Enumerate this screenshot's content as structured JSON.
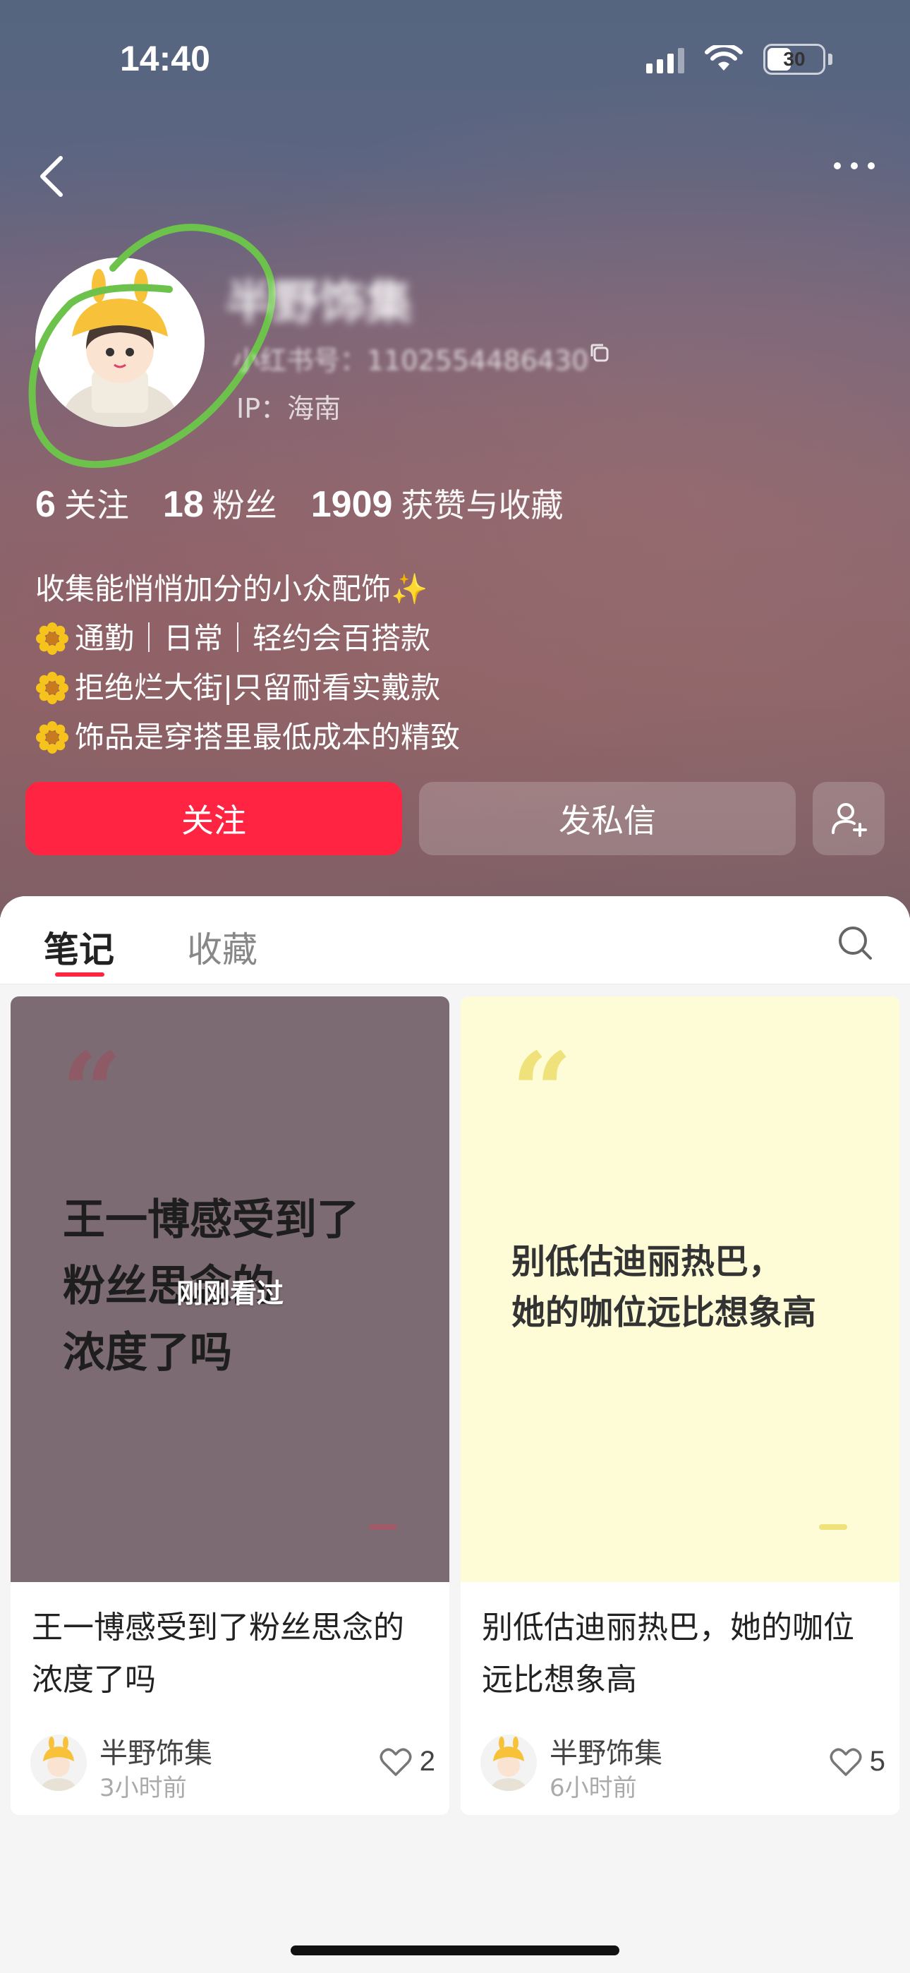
{
  "status_bar": {
    "time": "14:40",
    "battery": "30"
  },
  "profile": {
    "name": "半野饰集",
    "redbook_id": "小红书号：1102554486430",
    "ip": "IP：海南"
  },
  "stats": [
    {
      "num": "6",
      "label": "关注"
    },
    {
      "num": "18",
      "label": "粉丝"
    },
    {
      "num": "1909",
      "label": "获赞与收藏"
    }
  ],
  "bio": {
    "line1": "收集能悄悄加分的小众配饰✨",
    "line2": "通勤｜日常｜轻约会百搭款",
    "line3": "拒绝烂大街|只留耐看实戴款",
    "line4": "饰品是穿搭里最低成本的精致"
  },
  "actions": {
    "follow": "关注",
    "message": "发私信"
  },
  "tabs": {
    "notes": "笔记",
    "collect": "收藏"
  },
  "notes": [
    {
      "cover_line1": "王一博感受到了",
      "cover_line2": "粉丝思念的",
      "cover_line3": "浓度了吗",
      "seen": "刚刚看过",
      "title": "王一博感受到了粉丝思念的浓度了吗",
      "author": "半野饰集",
      "time": "3小时前",
      "likes": "2"
    },
    {
      "cover_line1": "别低估迪丽热巴，",
      "cover_line2": "她的咖位远比想象高",
      "title": "别低估迪丽热巴，她的咖位远比想象高",
      "author": "半野饰集",
      "time": "6小时前",
      "likes": "5"
    }
  ],
  "colors": {
    "accent": "#ff2442",
    "annotation_circle": "#6cc24a"
  },
  "icons": [
    "back-arrow-icon",
    "more-icon",
    "copy-icon",
    "add-friend-icon",
    "search-icon",
    "heart-icon",
    "sun-emoji-icon"
  ]
}
